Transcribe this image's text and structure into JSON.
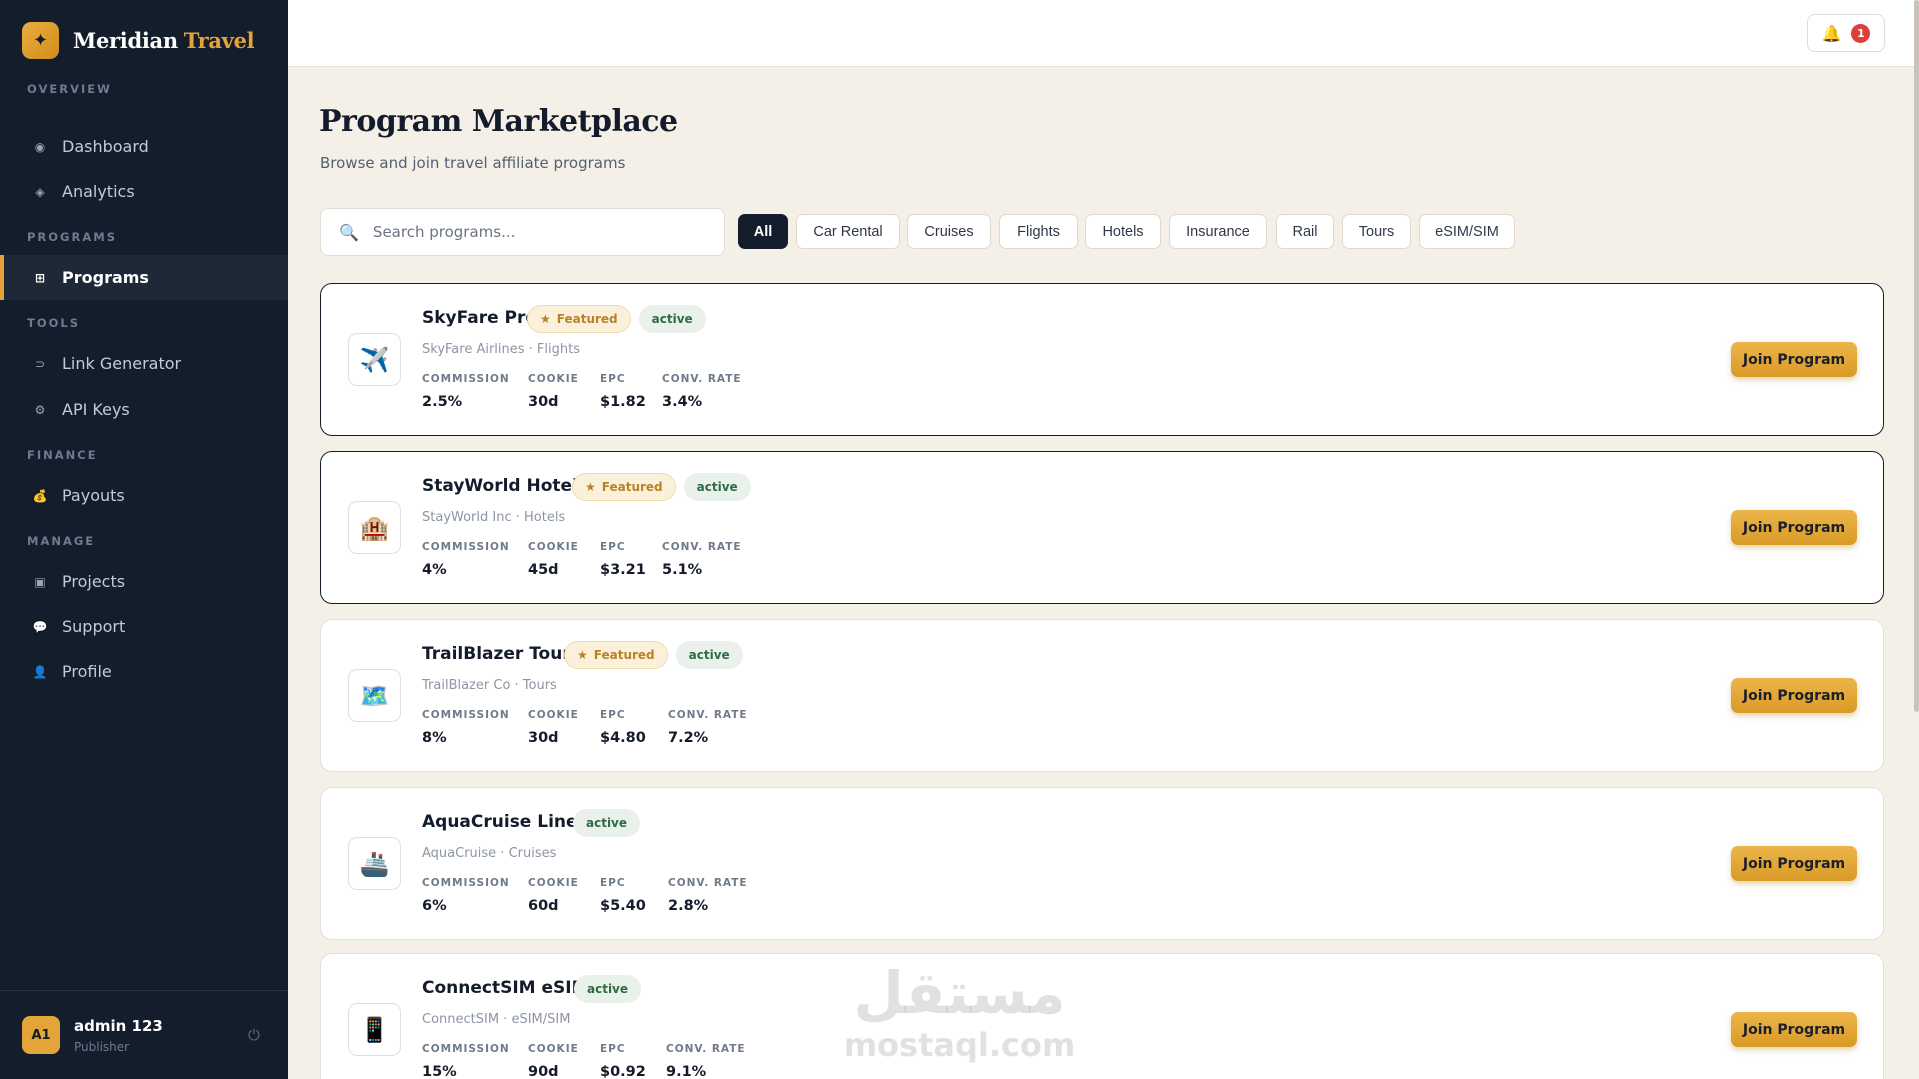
{
  "brand": {
    "name": "Meridian",
    "accent": "Travel",
    "logo_icon": "compass-star-icon"
  },
  "sidebar": {
    "sections": [
      {
        "label": "OVERVIEW",
        "items": [
          {
            "label": "Dashboard",
            "icon": "dot-icon"
          },
          {
            "label": "Analytics",
            "icon": "diamond-icon"
          }
        ]
      },
      {
        "label": "PROGRAMS",
        "items": [
          {
            "label": "Programs",
            "icon": "grid-icon",
            "active": true
          }
        ]
      },
      {
        "label": "TOOLS",
        "items": [
          {
            "label": "Link Generator",
            "icon": "link-icon"
          },
          {
            "label": "API Keys",
            "icon": "gear-icon"
          }
        ]
      },
      {
        "label": "FINANCE",
        "items": [
          {
            "label": "Payouts",
            "icon": "money-bag-icon"
          }
        ]
      },
      {
        "label": "MANAGE",
        "items": [
          {
            "label": "Projects",
            "icon": "square-icon"
          },
          {
            "label": "Support",
            "icon": "chat-bubble-icon"
          },
          {
            "label": "Profile",
            "icon": "user-icon"
          }
        ]
      }
    ]
  },
  "user": {
    "initials": "A1",
    "name": "admin 123",
    "role": "Publisher"
  },
  "header": {
    "notification_count": "1"
  },
  "main": {
    "title": "Program Marketplace",
    "subtitle": "Browse and join travel affiliate programs",
    "search_placeholder": "Search programs...",
    "filters": [
      "All",
      "Car Rental",
      "Cruises",
      "Flights",
      "Hotels",
      "Insurance",
      "Rail",
      "Tours",
      "eSIM/SIM"
    ],
    "active_filter": "All",
    "stat_labels": {
      "commission": "COMMISSION",
      "cookie": "COOKIE",
      "epc": "EPC",
      "conv_rate": "CONV. RATE"
    },
    "featured_label": "Featured",
    "join_label": "Join Program",
    "programs": [
      {
        "name": "SkyFare Pro",
        "featured": true,
        "status": "active",
        "company": "SkyFare Airlines · Flights",
        "icon": "airplane-icon",
        "commission": "2.5%",
        "cookie": "30d",
        "epc": "$1.82",
        "conv_rate": "3.4%"
      },
      {
        "name": "StayWorld Hotels",
        "featured": true,
        "status": "active",
        "company": "StayWorld Inc · Hotels",
        "icon": "hotel-icon",
        "commission": "4%",
        "cookie": "45d",
        "epc": "$3.21",
        "conv_rate": "5.1%"
      },
      {
        "name": "TrailBlazer Tours",
        "featured": true,
        "status": "active",
        "company": "TrailBlazer Co · Tours",
        "icon": "map-icon",
        "commission": "8%",
        "cookie": "30d",
        "epc": "$4.80",
        "conv_rate": "7.2%"
      },
      {
        "name": "AquaCruise Lines",
        "featured": false,
        "status": "active",
        "company": "AquaCruise · Cruises",
        "icon": "ship-icon",
        "commission": "6%",
        "cookie": "60d",
        "epc": "$5.40",
        "conv_rate": "2.8%"
      },
      {
        "name": "ConnectSIM eSIM",
        "featured": false,
        "status": "active",
        "company": "ConnectSIM · eSIM/SIM",
        "icon": "phone-icon",
        "commission": "15%",
        "cookie": "90d",
        "epc": "$0.92",
        "conv_rate": "9.1%"
      }
    ]
  },
  "watermark": {
    "arabic": "مستقل",
    "latin": "mostaql.com"
  },
  "colors": {
    "sidebar_bg": "#141d2c",
    "accent": "#e3a53a",
    "page_bg": "#f4f0e8",
    "badge_red": "#d9413a"
  }
}
